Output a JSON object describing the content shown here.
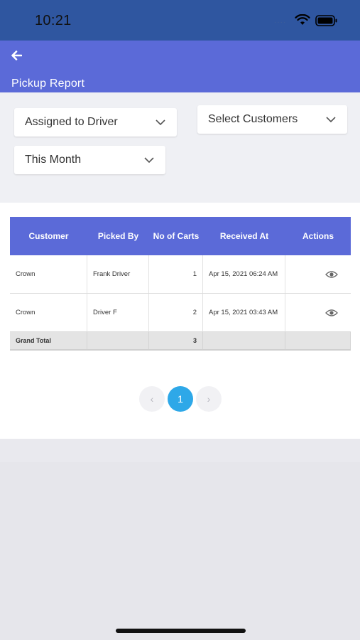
{
  "status_bar": {
    "time": "10:21",
    "signal": "····",
    "icons": [
      "wifi-icon",
      "battery-icon"
    ]
  },
  "appbar": {
    "title": "Pickup Report",
    "back_icon": "back-arrow-icon",
    "color": "#5b6ad8"
  },
  "filters": {
    "assigned": "Assigned to Driver",
    "customers": "Select Customers",
    "period": "This Month"
  },
  "table": {
    "columns": [
      "Customer",
      "Picked By",
      "No of Carts",
      "Received At",
      "Actions"
    ],
    "rows": [
      {
        "customer": "Crown",
        "picked_by": "Frank Driver",
        "carts": "1",
        "received_at": "Apr 15, 2021 06:24 AM",
        "action_icon": "eye-icon"
      },
      {
        "customer": "Crown",
        "picked_by": "Driver F",
        "carts": "2",
        "received_at": "Apr 15, 2021 03:43 AM",
        "action_icon": "eye-icon"
      }
    ],
    "total": {
      "label": "Grand Total",
      "carts": "3"
    }
  },
  "pagination": {
    "prev": "‹",
    "current": "1",
    "next": "›",
    "accent": "#2ea8e8"
  }
}
